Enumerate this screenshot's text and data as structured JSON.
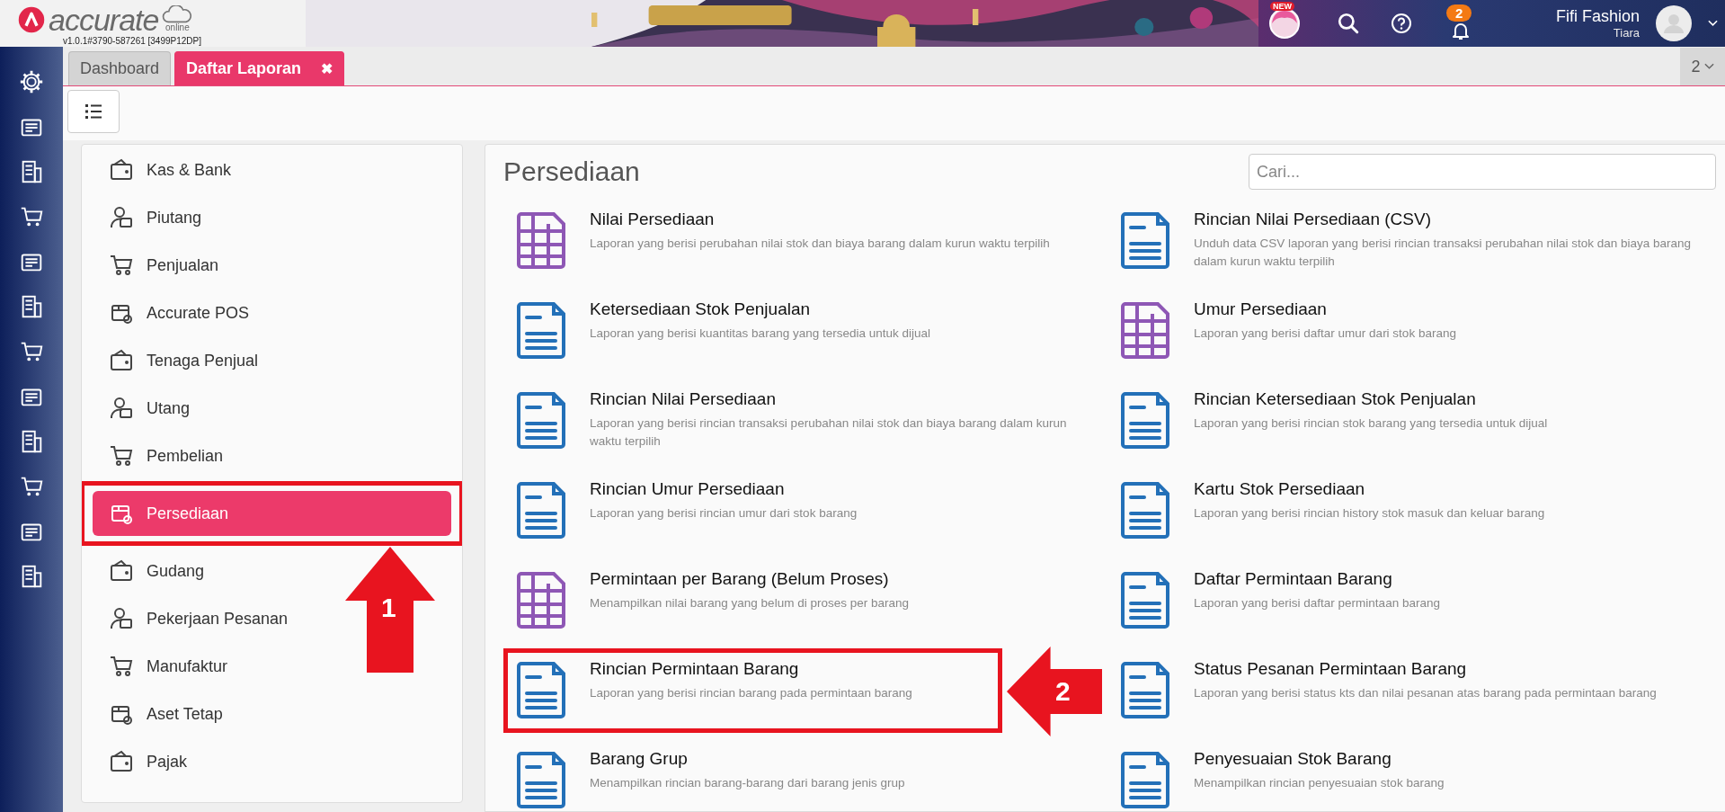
{
  "header": {
    "logo_text": "accurate",
    "logo_sub": "online",
    "version": "v1.0.1#3790-587261 [3499P12DP]",
    "new_badge": "NEW",
    "notification_count": "2",
    "company": "Fifi Fashion",
    "user": "Tiara"
  },
  "tabs": [
    {
      "label": "Dashboard",
      "selected": false,
      "closable": false
    },
    {
      "label": "Daftar Laporan",
      "selected": true,
      "closable": true
    }
  ],
  "tab_close": "✖",
  "tab_count": "2",
  "sidebar": {
    "items": [
      {
        "label": "Kas & Bank",
        "selected": false,
        "highlighted": false
      },
      {
        "label": "Piutang",
        "selected": false,
        "highlighted": false
      },
      {
        "label": "Penjualan",
        "selected": false,
        "highlighted": false
      },
      {
        "label": "Accurate POS",
        "selected": false,
        "highlighted": false
      },
      {
        "label": "Tenaga Penjual",
        "selected": false,
        "highlighted": false
      },
      {
        "label": "Utang",
        "selected": false,
        "highlighted": false
      },
      {
        "label": "Pembelian",
        "selected": false,
        "highlighted": false
      },
      {
        "label": "Persediaan",
        "selected": true,
        "highlighted": true
      },
      {
        "label": "Gudang",
        "selected": false,
        "highlighted": false
      },
      {
        "label": "Pekerjaan Pesanan",
        "selected": false,
        "highlighted": false
      },
      {
        "label": "Manufaktur",
        "selected": false,
        "highlighted": false
      },
      {
        "label": "Aset Tetap",
        "selected": false,
        "highlighted": false
      },
      {
        "label": "Pajak",
        "selected": false,
        "highlighted": false
      }
    ]
  },
  "reports": {
    "title": "Persediaan",
    "search": {
      "placeholder": "Cari..."
    },
    "items": [
      {
        "kind": "table",
        "title": "Nilai Persediaan",
        "description": "Laporan yang berisi perubahan nilai stok dan biaya barang dalam kurun waktu terpilih",
        "highlighted": false
      },
      {
        "kind": "document",
        "title": "Rincian Nilai Persediaan (CSV)",
        "description": "Unduh data CSV laporan yang berisi rincian transaksi perubahan nilai stok dan biaya barang dalam kurun waktu terpilih",
        "highlighted": false
      },
      {
        "kind": "document",
        "title": "Ketersediaan Stok Penjualan",
        "description": "Laporan yang berisi kuantitas barang yang tersedia untuk dijual",
        "highlighted": false
      },
      {
        "kind": "table",
        "title": "Umur Persediaan",
        "description": "Laporan yang berisi daftar umur dari stok barang",
        "highlighted": false
      },
      {
        "kind": "document",
        "title": "Rincian Nilai Persediaan",
        "description": "Laporan yang berisi rincian transaksi perubahan nilai stok dan biaya barang dalam kurun waktu terpilih",
        "highlighted": false
      },
      {
        "kind": "document",
        "title": "Rincian Ketersediaan Stok Penjualan",
        "description": "Laporan yang berisi rincian stok barang yang tersedia untuk dijual",
        "highlighted": false
      },
      {
        "kind": "document",
        "title": "Rincian Umur Persediaan",
        "description": "Laporan yang berisi rincian umur dari stok barang",
        "highlighted": false
      },
      {
        "kind": "document",
        "title": "Kartu Stok Persediaan",
        "description": "Laporan yang berisi rincian history stok masuk dan keluar barang",
        "highlighted": false
      },
      {
        "kind": "table",
        "title": "Permintaan per Barang (Belum Proses)",
        "description": "Menampilkan nilai barang yang belum di proses per barang",
        "highlighted": false
      },
      {
        "kind": "document",
        "title": "Daftar Permintaan Barang",
        "description": "Laporan yang berisi daftar permintaan barang",
        "highlighted": false
      },
      {
        "kind": "document",
        "title": "Rincian Permintaan Barang",
        "description": "Laporan yang berisi rincian barang pada permintaan barang",
        "highlighted": true
      },
      {
        "kind": "document",
        "title": "Status Pesanan Permintaan Barang",
        "description": "Laporan yang berisi status kts dan nilai pesanan atas barang pada permintaan barang",
        "highlighted": false
      },
      {
        "kind": "document",
        "title": "Barang Grup",
        "description": "Menampilkan rincian barang-barang dari barang jenis grup",
        "highlighted": false
      },
      {
        "kind": "document",
        "title": "Penyesuaian Stok Barang",
        "description": "Menampilkan rincian penyesuaian stok barang",
        "highlighted": false
      }
    ]
  },
  "callouts": [
    {
      "label": "1"
    },
    {
      "label": "2"
    }
  ]
}
